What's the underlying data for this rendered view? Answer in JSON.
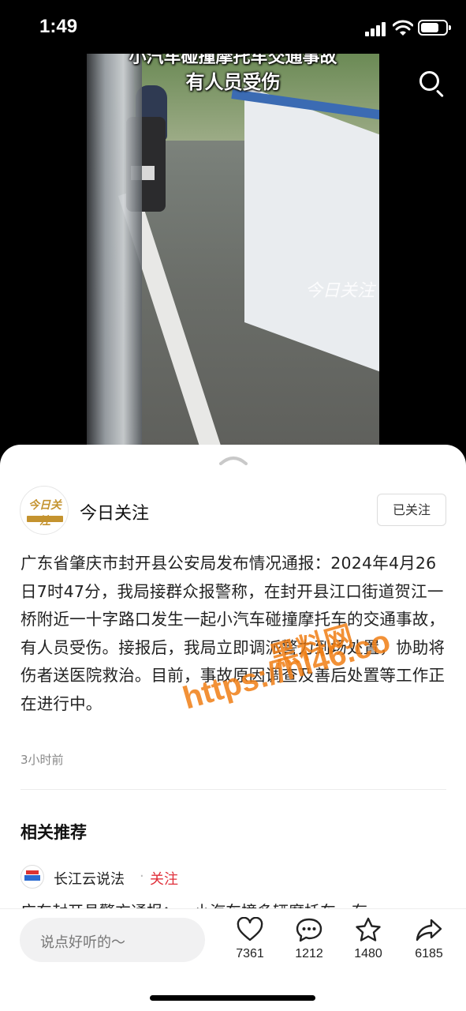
{
  "status_bar": {
    "time": "1:49"
  },
  "video": {
    "caption_top": "小汽车碰撞摩托车交通事故",
    "caption_main": "有人员受伤",
    "watermark": "今日关注"
  },
  "search": {
    "icon": "search-icon"
  },
  "post": {
    "author": "今日关注",
    "follow_status": "已关注",
    "content": "广东省肇庆市封开县公安局发布情况通报：2024年4月26日7时47分，我局接群众报警称，在封开县江口街道贺江一桥附近一十字路口发生一起小汽车碰撞摩托车的交通事故，有人员受伤。接报后，我局立即调派警力到场处置，协助将伤者送医院救治。目前，事故原因调查及善后处置等工作正在进行中。",
    "time_ago": "3小时前"
  },
  "recommendations": {
    "title": "相关推荐",
    "items": [
      {
        "author": "长江云说法",
        "follow_label": "关注",
        "snippet": "广东封开县警方通报：一小汽车撞多辆摩托车，有"
      }
    ]
  },
  "overlay_watermark": {
    "line1": "黑料网",
    "line2": "https://hl46.co"
  },
  "bottom_bar": {
    "comment_placeholder": "说点好听的～",
    "actions": [
      {
        "icon": "heart-icon",
        "count": "7361"
      },
      {
        "icon": "comment-icon",
        "count": "1212"
      },
      {
        "icon": "star-icon",
        "count": "1480"
      },
      {
        "icon": "share-icon",
        "count": "6185"
      }
    ]
  },
  "colors": {
    "accent_red": "#e0303b",
    "watermark_orange": "#f07e14",
    "logo_gold": "#c4932f"
  }
}
